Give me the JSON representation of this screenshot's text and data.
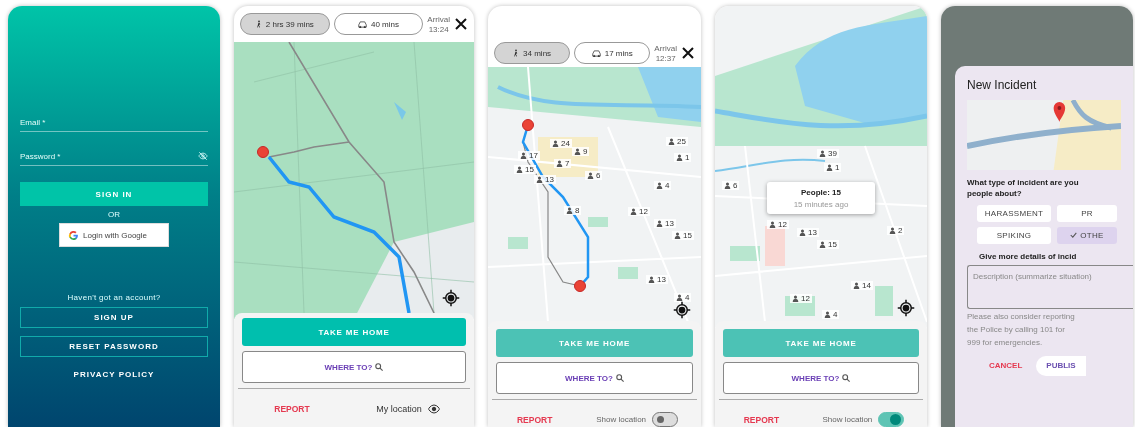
{
  "login": {
    "email_label": "Email *",
    "password_label": "Password *",
    "sign_in": "SIGN IN",
    "or": "OR",
    "google_button": "Login with Google",
    "prompt": "Haven't got an account?",
    "sign_up": "SIGN UP",
    "reset_password": "RESET PASSWORD",
    "privacy_policy": "PRIVACY POLICY"
  },
  "map_screens": [
    {
      "kind": "route_top",
      "travel_modes": [
        {
          "kind": "walk",
          "label": "2 hrs 39 mins",
          "selected": true
        },
        {
          "kind": "car",
          "label": "40 mins",
          "selected": false
        }
      ],
      "arrival_label": "Arrival",
      "arrival_time": "13:24",
      "take_me_home": "TAKE ME HOME",
      "where_to": "WHERE TO?",
      "report": "REPORT",
      "location": {
        "kind": "eye",
        "label": "My location",
        "on": true
      }
    },
    {
      "kind": "route_below",
      "travel_modes": [
        {
          "kind": "walk",
          "label": "34 mins",
          "selected": true
        },
        {
          "kind": "car",
          "label": "17 mins",
          "selected": false
        }
      ],
      "arrival_label": "Arrival",
      "arrival_time": "12:37",
      "markers": [
        "17",
        "15",
        "24",
        "9",
        "7",
        "13",
        "6",
        "25",
        "1",
        "4",
        "8",
        "12",
        "13",
        "15",
        "13",
        "4"
      ],
      "take_me_home": "TAKE ME HOME",
      "where_to": "WHERE TO?",
      "report": "REPORT",
      "location": {
        "kind": "toggle",
        "label": "Show location",
        "on": false
      }
    },
    {
      "kind": "map_only",
      "markers": [
        "39",
        "1",
        "6",
        "12",
        "13",
        "15",
        "2",
        "14",
        "12",
        "4"
      ],
      "popup": {
        "title": "People: 15",
        "subtitle": "15 minutes ago"
      },
      "take_me_home": "TAKE ME HOME",
      "where_to": "WHERE TO?",
      "report": "REPORT",
      "location": {
        "kind": "toggle",
        "label": "Show location",
        "on": true
      }
    }
  ],
  "incident_dialog": {
    "title": "New Incident",
    "question_lines": [
      "What type of incident are you",
      "people about?"
    ],
    "types": [
      {
        "label": "HARASSMENT",
        "selected": false
      },
      {
        "label": "PR",
        "selected": false
      },
      {
        "label": "SPIKING",
        "selected": false
      },
      {
        "label": "OTHE",
        "selected": true
      }
    ],
    "details_label": "Give more details of incid",
    "placeholder": "Description (summarize situation)",
    "note_lines": [
      "Please also consider reporting",
      "the Police by calling 101 for",
      "999 for emergencies."
    ],
    "cancel": "CANCEL",
    "publish": "PUBLIS"
  }
}
